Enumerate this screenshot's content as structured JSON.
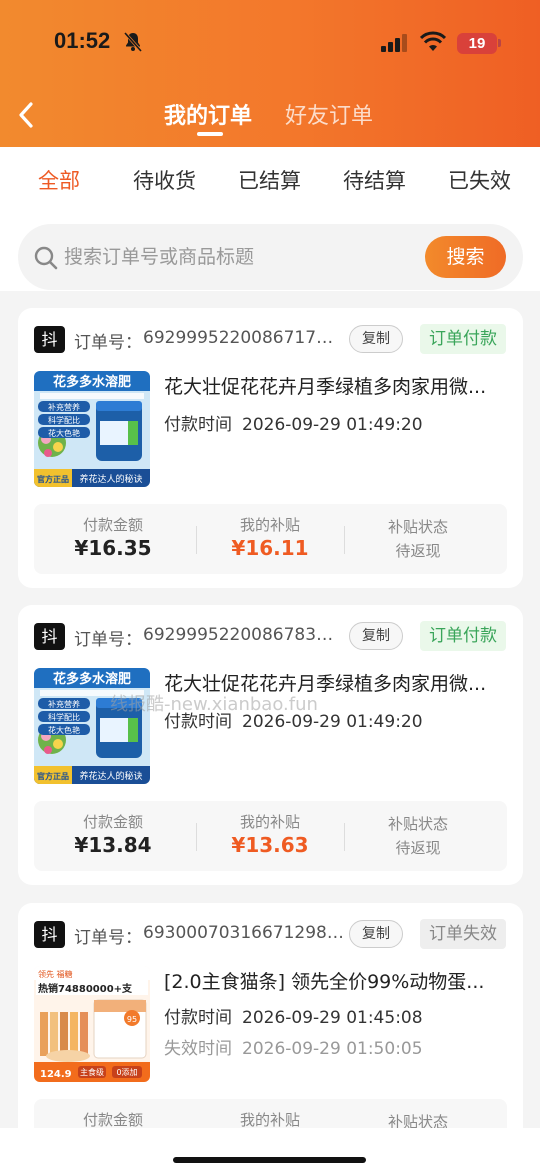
{
  "status_bar": {
    "time": "01:52",
    "battery": "19"
  },
  "nav": {
    "tabs": [
      "我的订单",
      "好友订单"
    ],
    "active": 0
  },
  "filters": {
    "items": [
      "全部",
      "待收货",
      "已结算",
      "待结算",
      "已失效"
    ],
    "active": 0
  },
  "search": {
    "placeholder": "搜索订单号或商品标题",
    "button": "搜索"
  },
  "watermark": "线报酷-new.xianbao.fun",
  "labels": {
    "platform_badge": "抖",
    "order_no": "订单号：",
    "copy": "复制",
    "pay_time": "付款时间",
    "invalid_time": "失效时间",
    "pay_amount": "付款金额",
    "my_subsidy": "我的补贴",
    "subsidy_status": "补贴状态"
  },
  "orders": [
    {
      "order_no": "69299952200867179...",
      "status": "订单付款",
      "title": "花大壮促花花卉月季绿植多肉家用微...",
      "pay_time": "2026-09-29 01:49:20",
      "amount": "¥16.35",
      "subsidy": "¥16.11",
      "subsidy_status": "待返现",
      "thumb": {
        "banner": "花多多水溶肥",
        "tags": [
          "补充营养",
          "科学配比",
          "花大色艳"
        ],
        "footer_left": "官方正品",
        "footer_right": "养花达人的秘诀"
      }
    },
    {
      "order_no": "69299952200867835...",
      "status": "订单付款",
      "title": "花大壮促花花卉月季绿植多肉家用微...",
      "pay_time": "2026-09-29 01:49:20",
      "amount": "¥13.84",
      "subsidy": "¥13.63",
      "subsidy_status": "待返现",
      "thumb": {
        "banner": "花多多水溶肥",
        "tags": [
          "补充营养",
          "科学配比",
          "花大色艳"
        ],
        "footer_left": "官方正品",
        "footer_right": "养花达人的秘诀"
      }
    },
    {
      "order_no": "6930007031667129891",
      "status": "订单失效",
      "title": "[2.0主食猫条] 领先全价99%动物蛋...",
      "pay_time": "2026-09-29 01:45:08",
      "invalid_time": "2026-09-29 01:50:05",
      "thumb": {
        "brand": "领先 福糖",
        "headline": "热销74880000+支",
        "badge": "95",
        "price": "124.9",
        "tag1": "主食级",
        "tag2": "0添加"
      }
    }
  ],
  "colors": {
    "accent": "#ef5b22",
    "header_start": "#f28a2e",
    "header_end": "#ef5f24",
    "paid_green": "#3aa55a"
  }
}
